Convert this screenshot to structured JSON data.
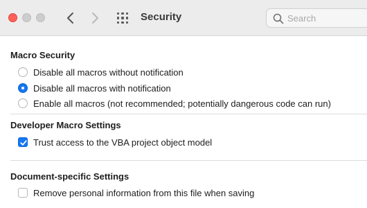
{
  "window": {
    "title": "Security",
    "controls": [
      "close",
      "minimize",
      "zoom"
    ]
  },
  "toolbar": {
    "back_icon": "chevron-left-icon",
    "forward_icon": "chevron-right-icon",
    "grid_icon": "grid-icon"
  },
  "search": {
    "placeholder": "Search",
    "value": ""
  },
  "colors": {
    "accent": "#1677f0",
    "close_light": "#ff5f57",
    "inactive_light": "#cdcdcd",
    "toolbar_bg": "#ececec"
  },
  "sections": {
    "macro_security": {
      "title": "Macro Security",
      "options": [
        {
          "label": "Disable all macros without notification",
          "selected": false
        },
        {
          "label": "Disable all macros with notification",
          "selected": true
        },
        {
          "label": "Enable all macros (not recommended; potentially dangerous code can run)",
          "selected": false
        }
      ]
    },
    "developer_macro": {
      "title": "Developer Macro Settings",
      "options": [
        {
          "label": "Trust access to the VBA project object model",
          "checked": true
        }
      ]
    },
    "document_specific": {
      "title": "Document-specific Settings",
      "options": [
        {
          "label": "Remove personal information from this file when saving",
          "checked": false
        }
      ]
    }
  }
}
